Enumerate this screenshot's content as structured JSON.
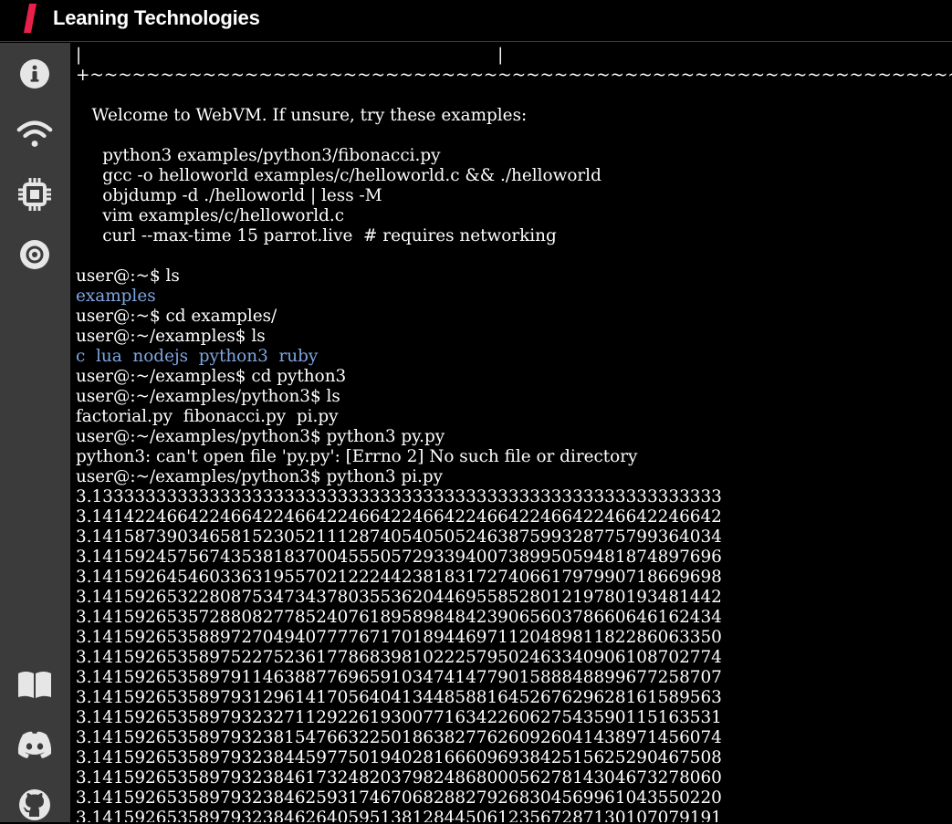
{
  "header": {
    "brand": "Leaning Technologies",
    "accent_color": "#e8214b"
  },
  "sidebar": {
    "items": [
      {
        "name": "info-icon",
        "label": "info"
      },
      {
        "name": "wifi-icon",
        "label": "networking"
      },
      {
        "name": "cpu-icon",
        "label": "cpu"
      },
      {
        "name": "disk-icon",
        "label": "disk"
      },
      {
        "name": "book-icon",
        "label": "documentation"
      },
      {
        "name": "discord-icon",
        "label": "discord"
      },
      {
        "name": "github-icon",
        "label": "github"
      }
    ]
  },
  "terminal": {
    "lines": [
      {
        "text": "|                                                                              |",
        "kind": "out"
      },
      {
        "text": "+~~~~~~~~~~~~~~~~~~~~~~~~~~~~~~~~~~~~~~~~~~~~~~~~~~~~~~~~~~~~~~~~~~~~~~~~~~~~~~+",
        "kind": "out"
      },
      {
        "text": "",
        "kind": "out"
      },
      {
        "text": "   Welcome to WebVM. If unsure, try these examples:",
        "kind": "out"
      },
      {
        "text": "",
        "kind": "out"
      },
      {
        "text": "     python3 examples/python3/fibonacci.py",
        "kind": "out"
      },
      {
        "text": "     gcc -o helloworld examples/c/helloworld.c && ./helloworld",
        "kind": "out"
      },
      {
        "text": "     objdump -d ./helloworld | less -M",
        "kind": "out"
      },
      {
        "text": "     vim examples/c/helloworld.c",
        "kind": "out"
      },
      {
        "text": "     curl --max-time 15 parrot.live  # requires networking",
        "kind": "out"
      },
      {
        "text": "",
        "kind": "out"
      },
      {
        "text": "user@:~$ ls",
        "kind": "out"
      },
      {
        "text": "examples",
        "kind": "dir"
      },
      {
        "text": "user@:~$ cd examples/",
        "kind": "out"
      },
      {
        "text": "user@:~/examples$ ls",
        "kind": "out"
      },
      {
        "text": "c  lua  nodejs  python3  ruby",
        "kind": "dir"
      },
      {
        "text": "user@:~/examples$ cd python3",
        "kind": "out"
      },
      {
        "text": "user@:~/examples/python3$ ls",
        "kind": "out"
      },
      {
        "text": "factorial.py  fibonacci.py  pi.py",
        "kind": "out"
      },
      {
        "text": "user@:~/examples/python3$ python3 py.py",
        "kind": "out"
      },
      {
        "text": "python3: can't open file 'py.py': [Errno 2] No such file or directory",
        "kind": "out"
      },
      {
        "text": "user@:~/examples/python3$ python3 pi.py",
        "kind": "out"
      },
      {
        "text": "3.13333333333333333333333333333333333333333333333333333333333",
        "kind": "out"
      },
      {
        "text": "3.14142246642246642246642246642246642246642246642246642246642",
        "kind": "out"
      },
      {
        "text": "3.14158739034658152305211128740540505246387599328775799364034",
        "kind": "out"
      },
      {
        "text": "3.14159245756743538183700455505729339400738995059481874897696",
        "kind": "out"
      },
      {
        "text": "3.14159264546033631955702122244238183172740661797990718669698",
        "kind": "out"
      },
      {
        "text": "3.14159265322808753473437803553620446955852801219780193481442",
        "kind": "out"
      },
      {
        "text": "3.14159265357288082778524076189589848423906560378660646162434",
        "kind": "out"
      },
      {
        "text": "3.14159265358897270494077776717018944697112048981182286063350",
        "kind": "out"
      },
      {
        "text": "3.14159265358975227523617786839810222579502463340906108702774",
        "kind": "out"
      },
      {
        "text": "3.14159265358979114638877696591034741477901588848899677258707",
        "kind": "out"
      },
      {
        "text": "3.14159265358979312961417056404134485881645267629628161589563",
        "kind": "out"
      },
      {
        "text": "3.14159265358979323271129226193007716342260627543590115163531",
        "kind": "out"
      },
      {
        "text": "3.14159265358979323815476632250186382776260926041438971456074",
        "kind": "out"
      },
      {
        "text": "3.14159265358979323844597750194028166609693842515625290467508",
        "kind": "out"
      },
      {
        "text": "3.14159265358979323846173248203798248680005627814304673278060",
        "kind": "out"
      },
      {
        "text": "3.14159265358979323846259317467068288279268304569961043550220",
        "kind": "out"
      },
      {
        "text": "3.14159265358979323846264059513812844506123567287130107079191",
        "kind": "out"
      }
    ]
  }
}
